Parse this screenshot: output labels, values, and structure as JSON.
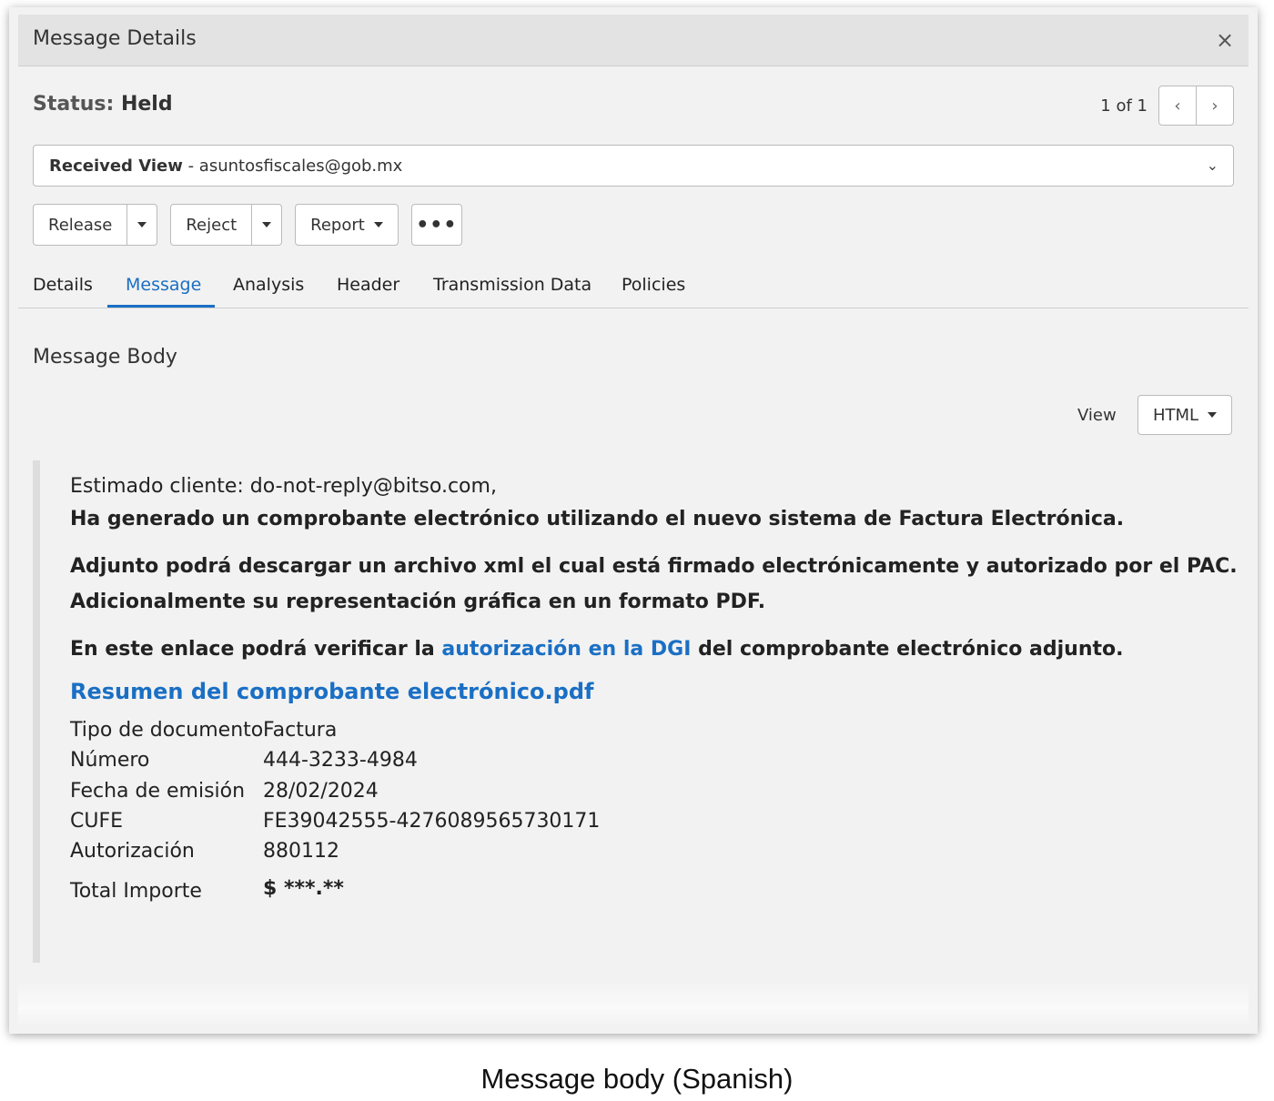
{
  "dialog": {
    "title": "Message Details",
    "close_icon": "×"
  },
  "status": {
    "label": "Status:",
    "value": "Held"
  },
  "pager": {
    "count": "1 of 1",
    "prev_icon": "‹",
    "next_icon": "›"
  },
  "view_select": {
    "bold_label": "Received View",
    "separator": " - ",
    "value": "asuntosfiscales@gob.mx",
    "chevron": "⌄"
  },
  "actions": {
    "release": "Release",
    "reject": "Reject",
    "report": "Report",
    "more": "•••"
  },
  "tabs": [
    "Details",
    "Message",
    "Analysis",
    "Header",
    "Transmission Data",
    "Policies"
  ],
  "active_tab": "Message",
  "message_body": {
    "title": "Message Body",
    "view_label": "View",
    "view_format": "HTML",
    "greeting": "Estimado cliente: do-not-reply@bitso.com,",
    "line1": "Ha generado un comprobante electrónico utilizando el nuevo sistema de Factura Electrónica.",
    "line2": "Adjunto podrá descargar un archivo xml el cual está firmado electrónicamente y autorizado por el PAC.",
    "line3": "Adicionalmente su representación gráfica en un formato PDF.",
    "line4_pre": "En este enlace podrá verificar la ",
    "line4_link": "autorización en la DGI",
    "line4_post": " del comprobante electrónico adjunto.",
    "pdf_link": "Resumen del comprobante electrónico.pdf",
    "fields": [
      {
        "label": "Tipo de documento",
        "value": "Factura"
      },
      {
        "label": "Número",
        "value": "444-3233-4984"
      },
      {
        "label": "Fecha de emisión",
        "value": "28/02/2024"
      },
      {
        "label": "CUFE",
        "value": "FE39042555-4276089565730171"
      },
      {
        "label": "Autorización",
        "value": "880112"
      }
    ],
    "total": {
      "label": "Total Importe",
      "value": "$ ***.**"
    }
  },
  "caption": "Message body (Spanish)",
  "colors": {
    "accent": "#1a6fc4",
    "titlebar": "#e3e3e3",
    "background": "#f2f2f2"
  }
}
